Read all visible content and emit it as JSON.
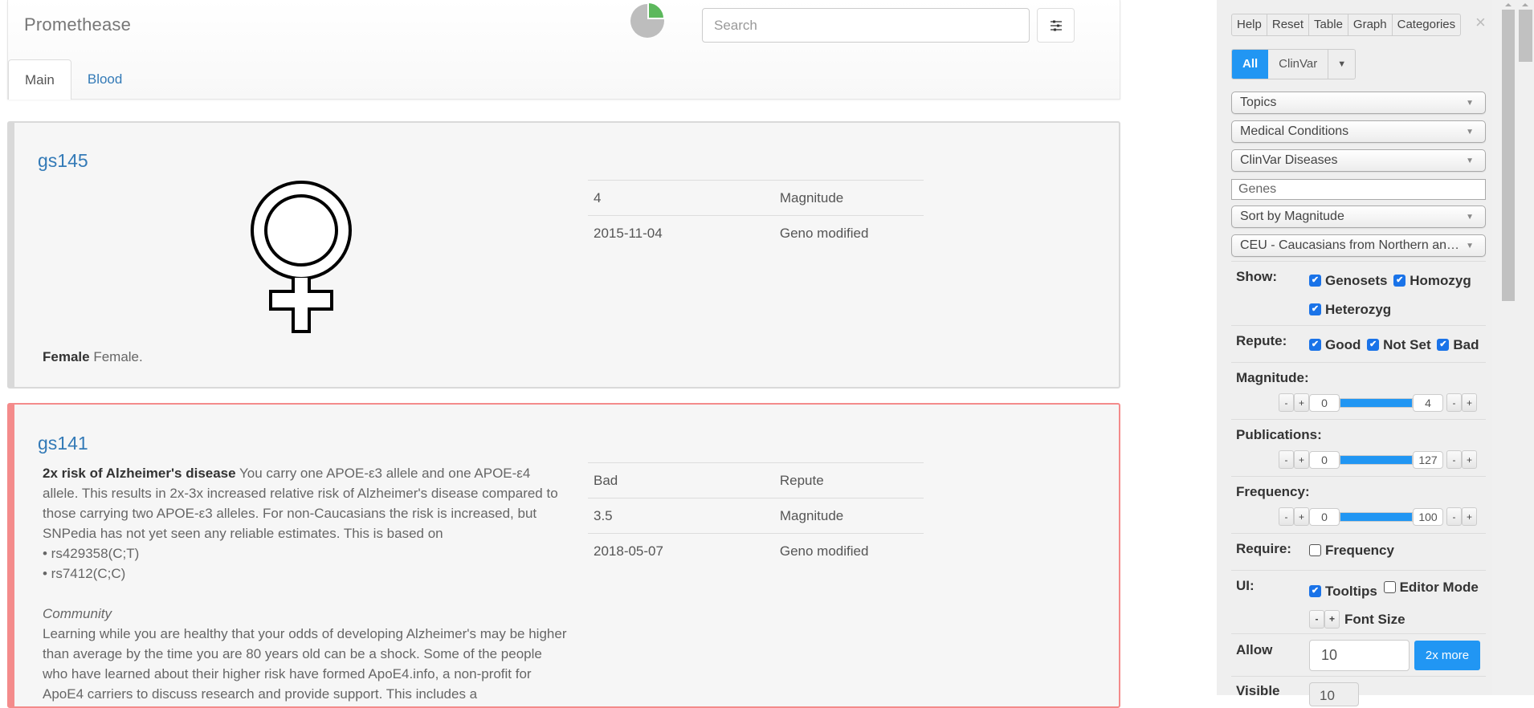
{
  "header": {
    "brand": "Promethease",
    "search_placeholder": "Search",
    "progress_pie": {
      "fraction_complete": 0.25,
      "colors": {
        "done": "#5cb85c",
        "remaining": "#bdbdbd"
      }
    },
    "tabs": [
      {
        "label": "Main",
        "active": true
      },
      {
        "label": "Blood",
        "active": false
      }
    ]
  },
  "cards": [
    {
      "id": "gs145",
      "repute": "neutral",
      "icon": "venus-female-symbol",
      "summary_title": "Female",
      "summary_text": "Female.",
      "props": [
        {
          "value": "4",
          "label": "Magnitude"
        },
        {
          "value": "2015-11-04",
          "label": "Geno modified"
        }
      ]
    },
    {
      "id": "gs141",
      "repute": "bad",
      "summary_title": "2x risk of Alzheimer's disease",
      "summary_text": "You carry one APOE-ε3 allele and one APOE-ε4 allele. This results in 2x-3x increased relative risk of Alzheimer's disease compared to those carrying two APOE-ε3 alleles. For non-Caucasians the risk is increased, but SNPedia has not yet seen any reliable estimates. This is based on",
      "bullets": [
        "• rs429358(C;T)",
        "• rs7412(C;C)"
      ],
      "community_heading": "Community",
      "community_text": "Learning while you are healthy that your odds of developing Alzheimer's may be higher than average by the time you are 80 years old can be a shock. Some of the people who have learned about their higher risk have formed ApoE4.info, a non-profit for ApoE4 carriers to discuss research and provide support. This includes a",
      "props": [
        {
          "value": "Bad",
          "label": "Repute"
        },
        {
          "value": "3.5",
          "label": "Magnitude"
        },
        {
          "value": "2018-05-07",
          "label": "Geno modified"
        }
      ]
    }
  ],
  "panel": {
    "toolbar": [
      "Help",
      "Reset",
      "Table",
      "Graph",
      "Categories"
    ],
    "close_label": "×",
    "modes": {
      "all": "All",
      "clinvar": "ClinVar",
      "active": "All"
    },
    "selects": {
      "topics": "Topics",
      "medical": "Medical Conditions",
      "clinvar_diseases": "ClinVar Diseases",
      "sort": "Sort by Magnitude",
      "population": "CEU - Caucasians from Northern an…"
    },
    "genes_placeholder": "Genes",
    "show": {
      "label": "Show:",
      "options": [
        {
          "label": "Genosets",
          "checked": true
        },
        {
          "label": "Homozyg",
          "checked": true
        },
        {
          "label": "Heterozyg",
          "checked": true
        }
      ]
    },
    "repute": {
      "label": "Repute:",
      "options": [
        {
          "label": "Good",
          "checked": true
        },
        {
          "label": "Not Set",
          "checked": true
        },
        {
          "label": "Bad",
          "checked": true
        }
      ]
    },
    "magnitude": {
      "label": "Magnitude:",
      "min": "0",
      "max": "4"
    },
    "publications": {
      "label": "Publications:",
      "min": "0",
      "max": "127"
    },
    "frequency": {
      "label": "Frequency:",
      "min": "0",
      "max": "100"
    },
    "require": {
      "label": "Require:",
      "options": [
        {
          "label": "Frequency",
          "checked": false
        }
      ]
    },
    "ui": {
      "label": "UI:",
      "options": [
        {
          "label": "Tooltips",
          "checked": true
        },
        {
          "label": "Editor Mode",
          "checked": false
        }
      ],
      "font_size_label": "Font Size"
    },
    "allow": {
      "label": "Allow",
      "value": "10",
      "button": "2x more"
    },
    "visible": {
      "label": "Visible",
      "value": "10"
    },
    "stepper": {
      "minus": "-",
      "plus": "+"
    }
  }
}
